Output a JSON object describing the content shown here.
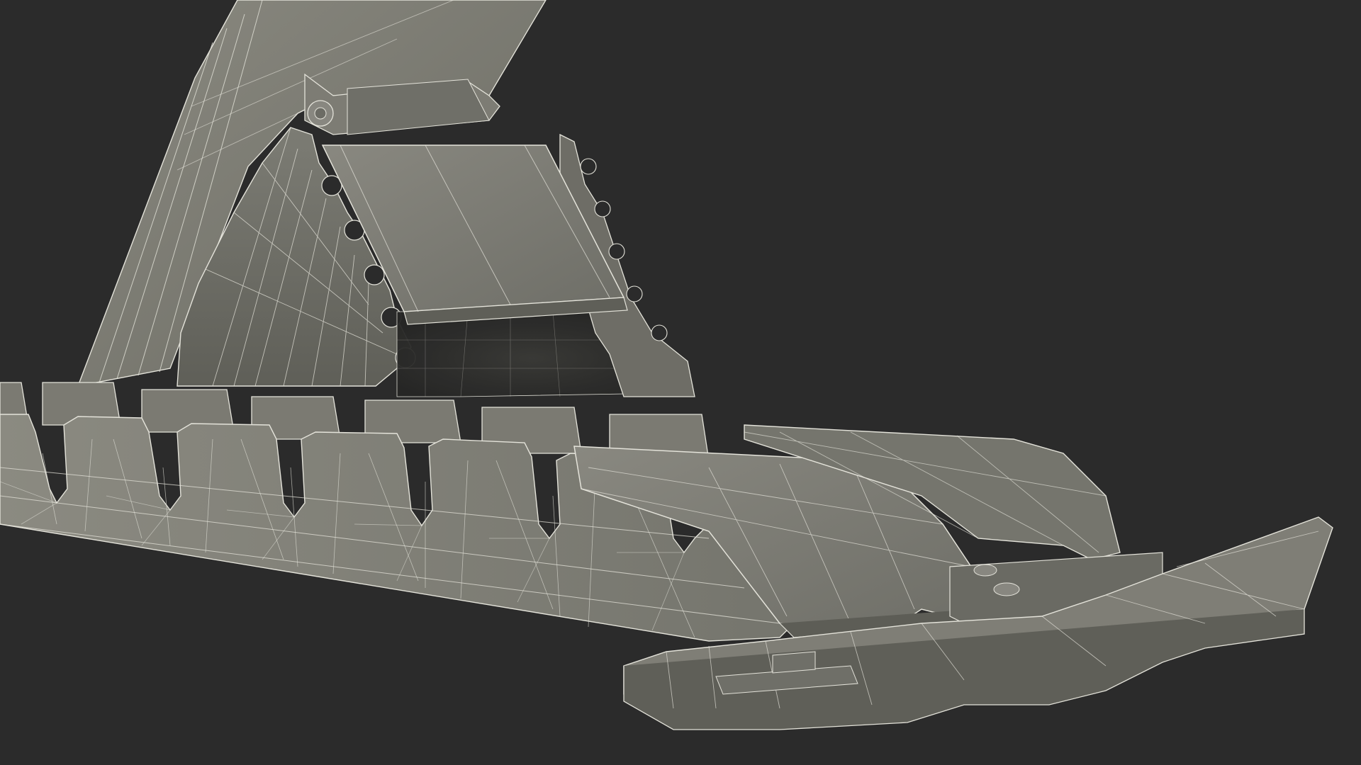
{
  "scene": {
    "colors": {
      "background": "#2b2b2b",
      "surface_light": "#8e8d84",
      "surface_mid": "#76766d",
      "surface_dark": "#5c5c55",
      "surface_shadow": "#45453f",
      "cavity": "#2e2e2c",
      "wire": "#e4e3da"
    }
  }
}
